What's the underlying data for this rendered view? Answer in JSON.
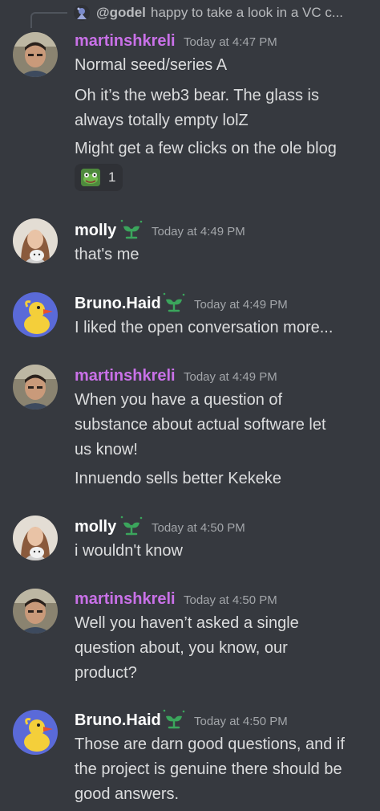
{
  "reply": {
    "username": "@godel",
    "preview": "happy to take a look in a VC c..."
  },
  "messages": [
    {
      "username": "martinshkreli",
      "timestamp": "Today at 4:47 PM",
      "lines": [
        "Normal seed/series A",
        "Oh it’s the web3 bear. The glass is",
        "always totally empty lolZ",
        "Might get a few clicks on the ole blog"
      ],
      "reaction": {
        "emoji": "frog-emoji",
        "count": "1"
      }
    },
    {
      "username": "molly",
      "timestamp": "Today at 4:49 PM",
      "lines": [
        "that's me"
      ]
    },
    {
      "username": "Bruno.Haid",
      "timestamp": "Today at 4:49 PM",
      "lines": [
        "I liked the open conversation more..."
      ]
    },
    {
      "username": "martinshkreli",
      "timestamp": "Today at 4:49 PM",
      "lines": [
        "When you have a question of",
        "substance about actual software let",
        "us know!",
        "Innuendo sells better Kekeke"
      ]
    },
    {
      "username": "molly",
      "timestamp": "Today at 4:50 PM",
      "lines": [
        "i wouldn't know"
      ]
    },
    {
      "username": "martinshkreli",
      "timestamp": "Today at 4:50 PM",
      "lines": [
        "Well you haven’t asked a single",
        "question about, you know, our",
        "product?"
      ]
    },
    {
      "username": "Bruno.Haid",
      "timestamp": "Today at 4:50 PM",
      "lines": [
        "Those are darn good questions, and if",
        "the project is genuine there should be",
        "good answers."
      ]
    }
  ],
  "colors": {
    "background": "#36393f",
    "martin_name": "#c971e8",
    "other_name": "#ffffff",
    "timestamp": "#a3a6aa",
    "badge": "#3ba55c"
  },
  "icons": {
    "badge": "sprout-badge-icon"
  }
}
